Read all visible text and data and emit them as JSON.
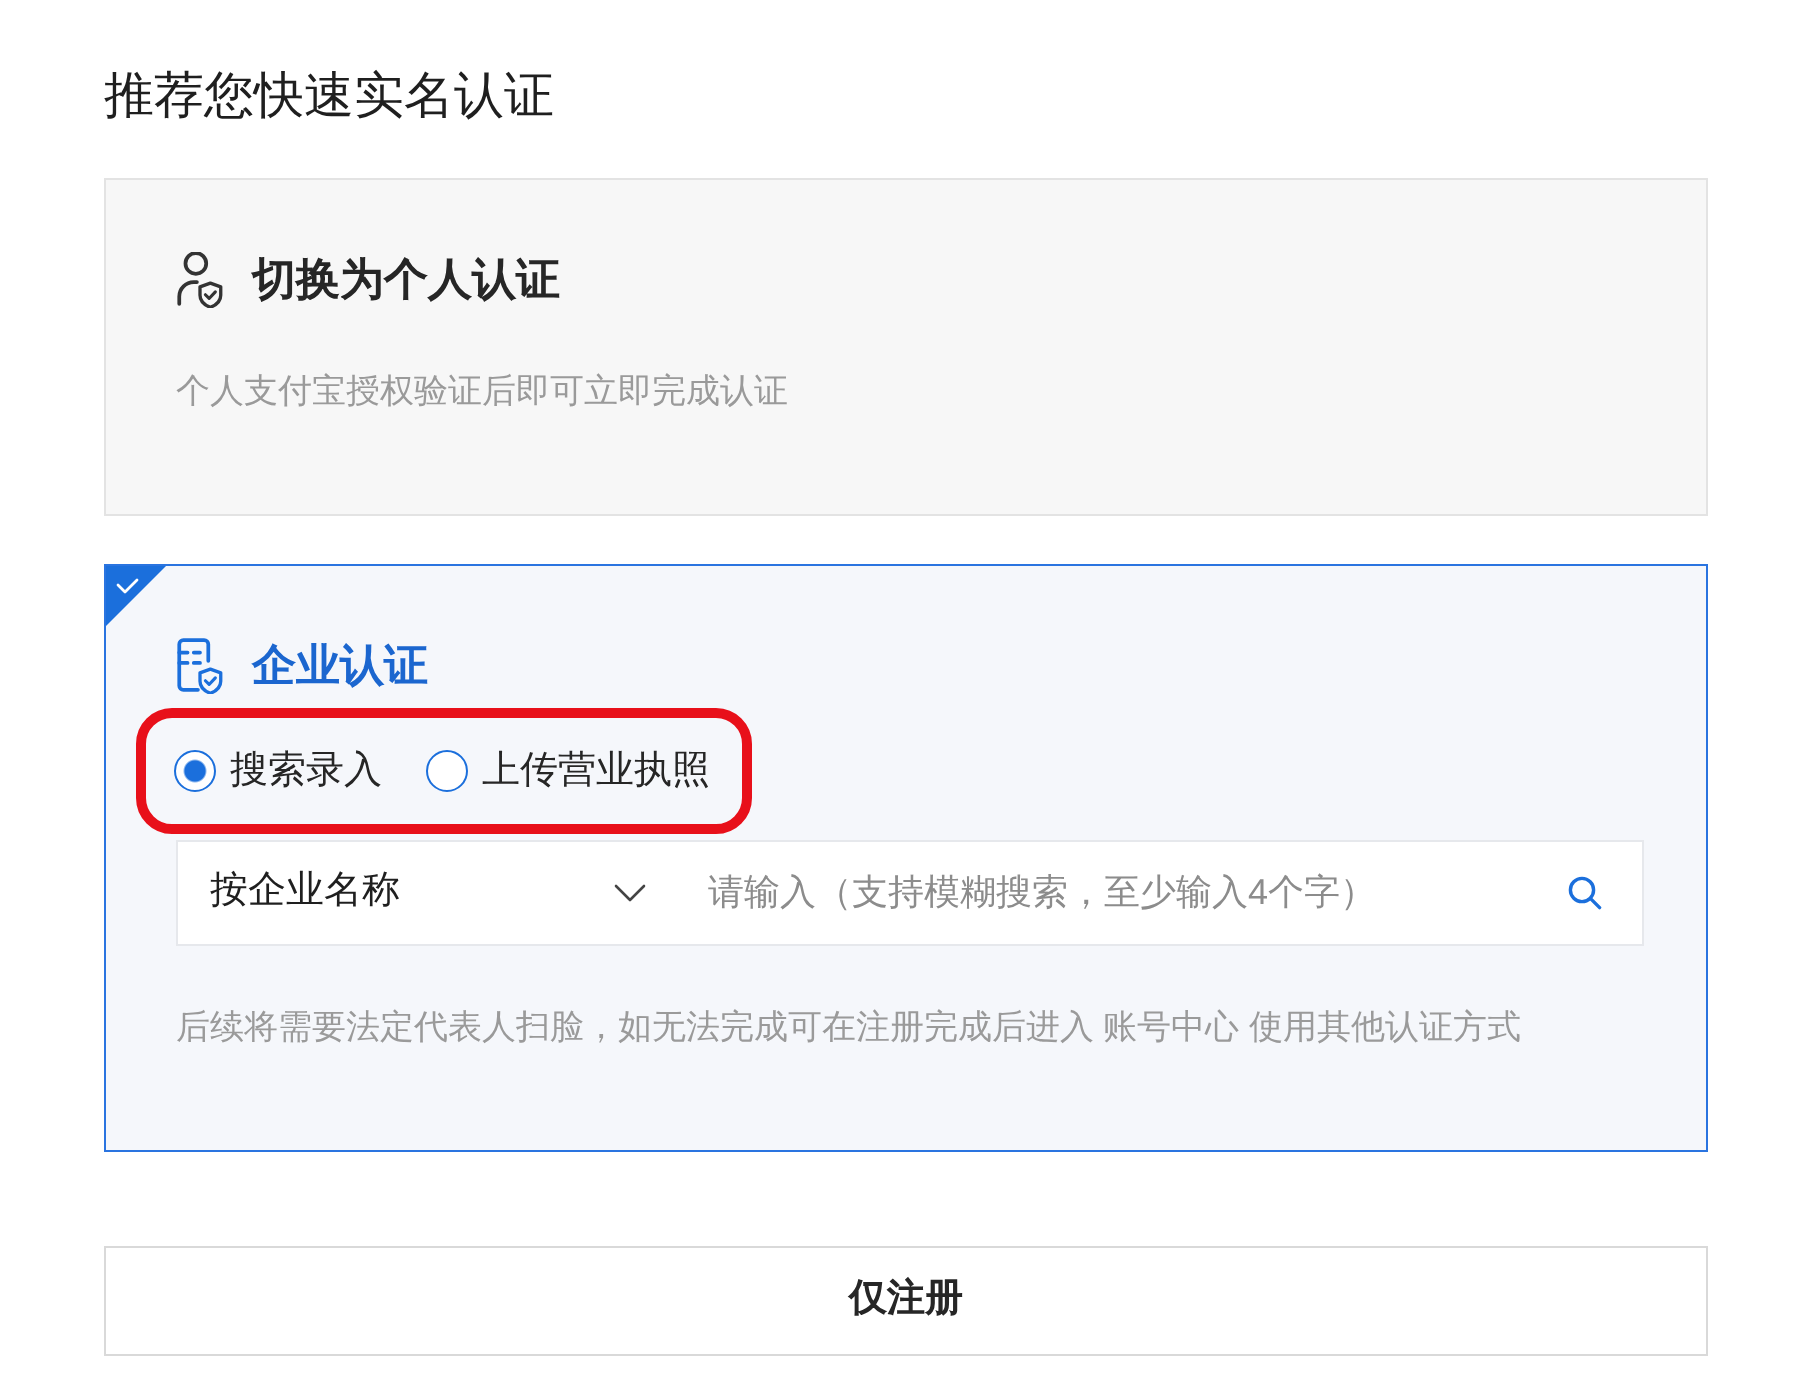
{
  "heading": "推荐您快速实名认证",
  "options": [
    {
      "kind": "personal",
      "title": "切换为个人认证",
      "description": "个人支付宝授权验证后即可立即完成认证",
      "selected": false
    },
    {
      "kind": "enterprise",
      "title": "企业认证",
      "selected": true,
      "methods_highlighted": true,
      "methods": [
        {
          "label": "搜索录入",
          "selected": true
        },
        {
          "label": "上传营业执照",
          "selected": false
        }
      ],
      "search": {
        "type_select": "按企业名称",
        "placeholder": "请输入（支持模糊搜索，至少输入4个字）"
      },
      "note": "后续将需要法定代表人扫脸，如无法完成可在注册完成后进入 账号中心 使用其他认证方式"
    }
  ],
  "register_button": "仅注册"
}
